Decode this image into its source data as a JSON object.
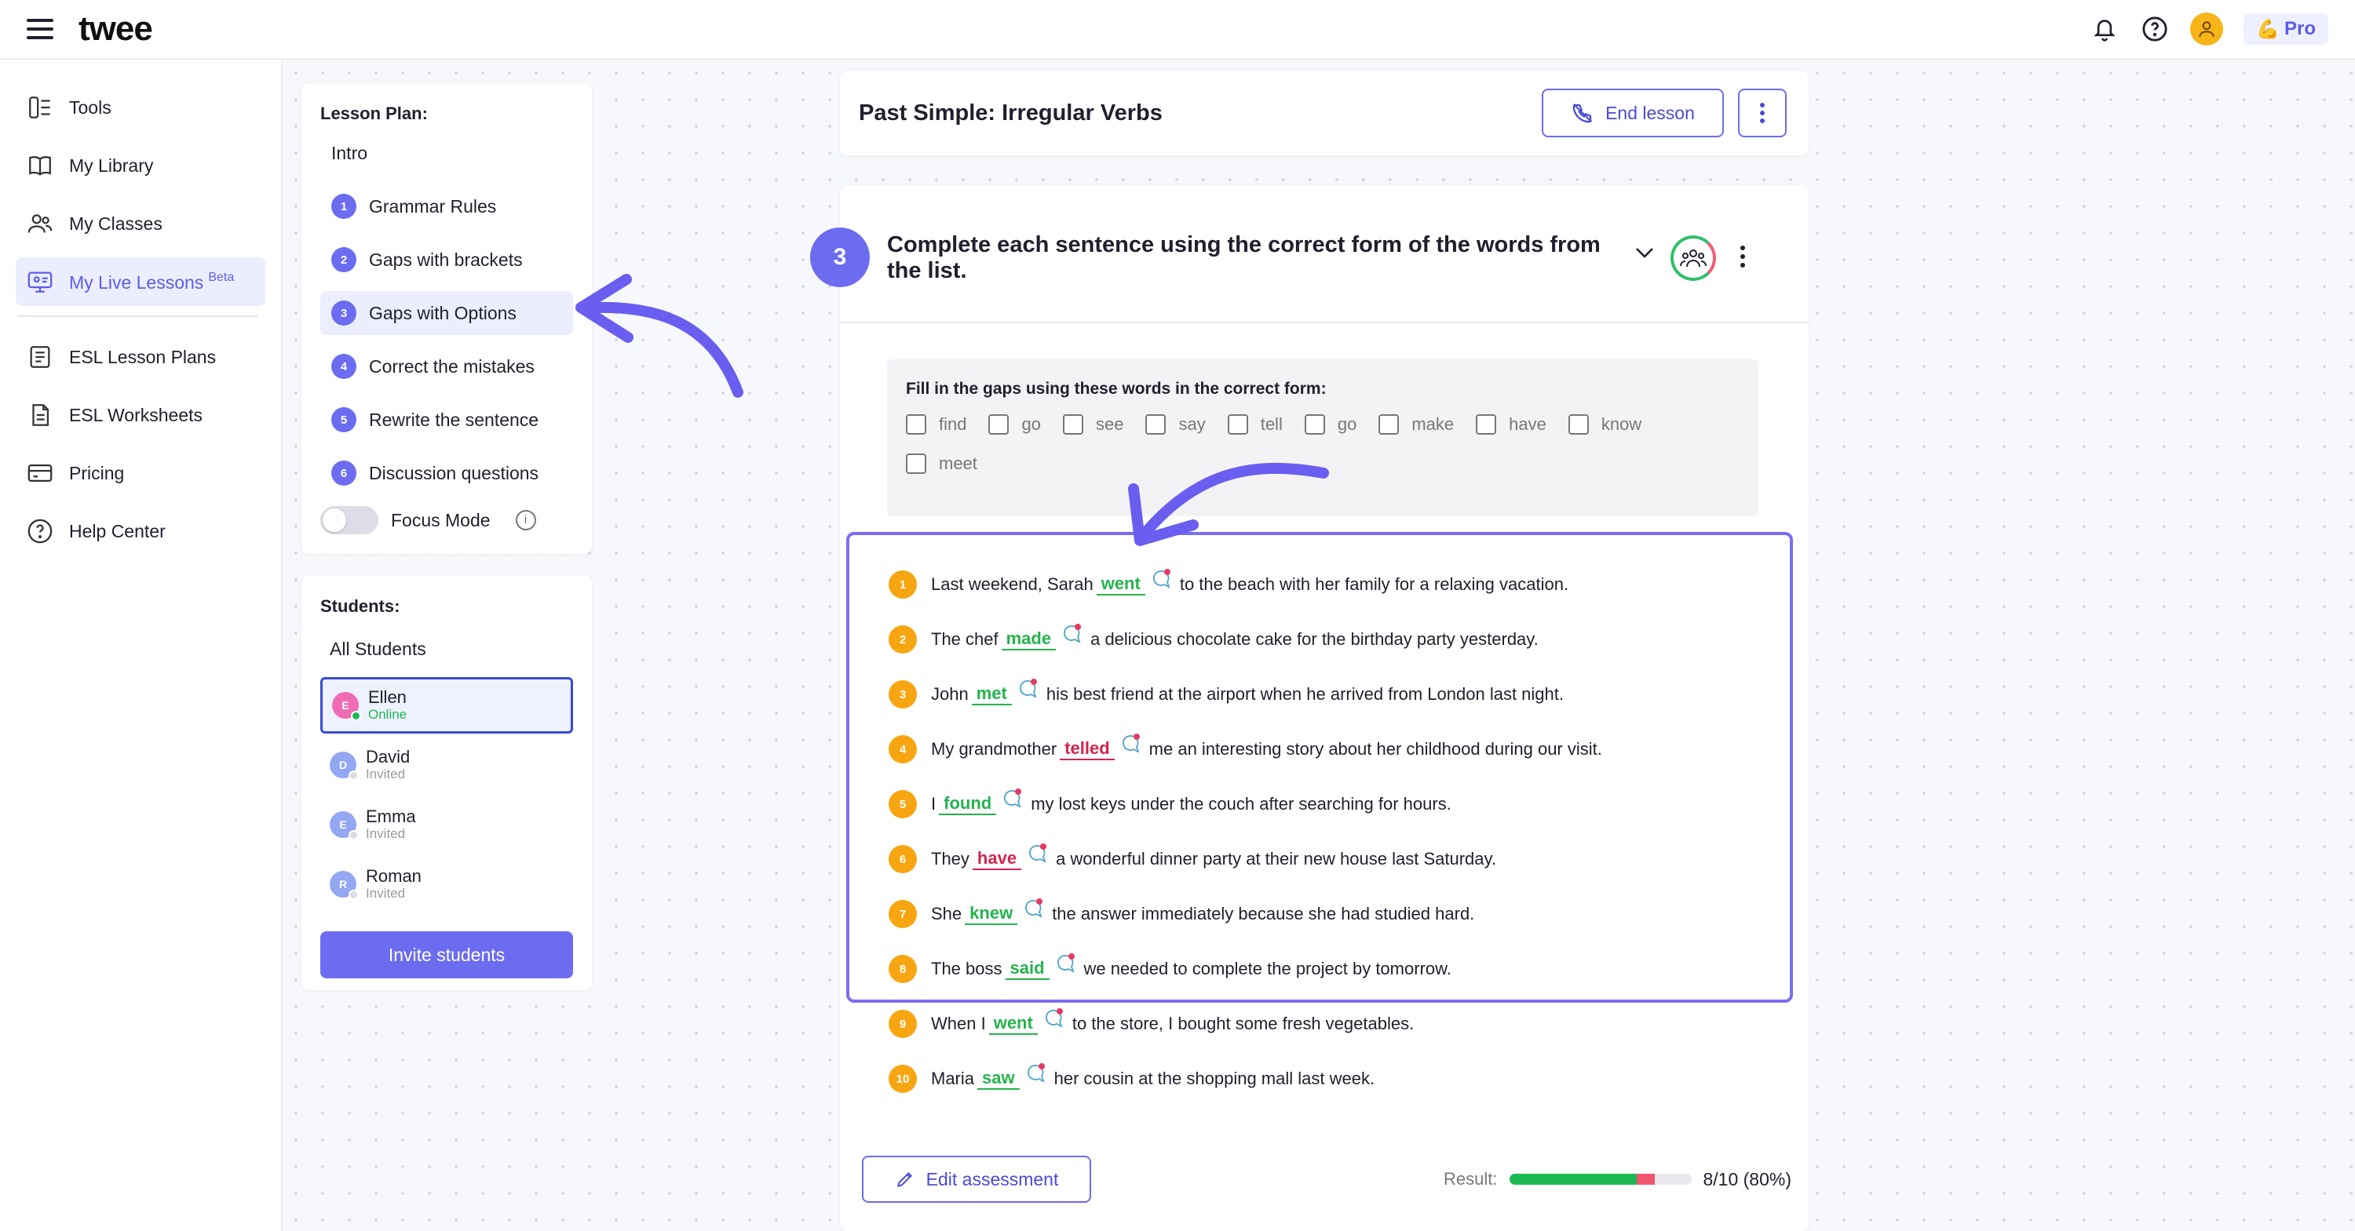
{
  "app": {
    "logo": "twee",
    "plan_badge": "Pro"
  },
  "nav": {
    "items": [
      {
        "label": "Tools",
        "icon": "tools-icon"
      },
      {
        "label": "My Library",
        "icon": "library-icon"
      },
      {
        "label": "My Classes",
        "icon": "classes-icon"
      },
      {
        "label": "My Live Lessons",
        "badge": "Beta",
        "icon": "live-lessons-icon",
        "active": true
      },
      {
        "label": "ESL Lesson Plans",
        "icon": "lesson-plans-icon"
      },
      {
        "label": "ESL Worksheets",
        "icon": "worksheets-icon"
      },
      {
        "label": "Pricing",
        "icon": "pricing-icon"
      },
      {
        "label": "Help Center",
        "icon": "help-icon"
      }
    ]
  },
  "lesson_plan": {
    "title": "Lesson Plan:",
    "intro": "Intro",
    "items": [
      {
        "num": "1",
        "label": "Grammar Rules"
      },
      {
        "num": "2",
        "label": "Gaps with brackets"
      },
      {
        "num": "3",
        "label": "Gaps with Options",
        "active": true
      },
      {
        "num": "4",
        "label": "Correct the mistakes"
      },
      {
        "num": "5",
        "label": "Rewrite the sentence"
      },
      {
        "num": "6",
        "label": "Discussion questions"
      }
    ],
    "focus_mode_label": "Focus Mode",
    "focus_mode_on": false
  },
  "students": {
    "title": "Students:",
    "all_label": "All Students",
    "list": [
      {
        "initial": "E",
        "name": "Ellen",
        "status": "Online",
        "color": "#f06bb5",
        "active": true
      },
      {
        "initial": "D",
        "name": "David",
        "status": "Invited",
        "color": "#93a7f2"
      },
      {
        "initial": "E",
        "name": "Emma",
        "status": "Invited",
        "color": "#93a7f2"
      },
      {
        "initial": "R",
        "name": "Roman",
        "status": "Invited",
        "color": "#93a7f2"
      }
    ],
    "invite_label": "Invite students"
  },
  "header": {
    "lesson_title": "Past Simple: Irregular Verbs",
    "end_label": "End lesson"
  },
  "exercise": {
    "number": "3",
    "title": "Complete each sentence using the correct form of the words from the list.",
    "word_box_title": "Fill in the gaps using these words in the correct form:",
    "words": [
      "find",
      "go",
      "see",
      "say",
      "tell",
      "go",
      "make",
      "have",
      "know",
      "meet"
    ],
    "sentences": [
      {
        "num": "1",
        "before": "Last weekend, Sarah",
        "answer": "went",
        "correct": true,
        "after": "to the beach with her family for a relaxing vacation."
      },
      {
        "num": "2",
        "before": "The chef",
        "answer": "made",
        "correct": true,
        "after": "a delicious chocolate cake for the birthday party yesterday."
      },
      {
        "num": "3",
        "before": "John",
        "answer": "met",
        "correct": true,
        "after": "his best friend at the airport when he arrived from London last night."
      },
      {
        "num": "4",
        "before": "My grandmother",
        "answer": "telled",
        "correct": false,
        "after": "me an interesting story about her childhood during our visit."
      },
      {
        "num": "5",
        "before": "I",
        "answer": "found",
        "correct": true,
        "after": "my lost keys under the couch after searching for hours."
      },
      {
        "num": "6",
        "before": "They",
        "answer": "have",
        "correct": false,
        "after": "a wonderful dinner party at their new house last Saturday."
      },
      {
        "num": "7",
        "before": "She",
        "answer": "knew",
        "correct": true,
        "after": "the answer immediately because she had studied hard."
      },
      {
        "num": "8",
        "before": "The boss",
        "answer": "said",
        "correct": true,
        "after": "we needed to complete the project by tomorrow."
      },
      {
        "num": "9",
        "before": "When I",
        "answer": "went",
        "correct": true,
        "after": "to the store, I bought some fresh vegetables."
      },
      {
        "num": "10",
        "before": "Maria",
        "answer": "saw",
        "correct": true,
        "after": "her cousin at the shopping mall last week."
      }
    ],
    "edit_label": "Edit assessment",
    "result_label": "Result:",
    "result_value": "8/10 (80%)",
    "result_fraction": 0.8
  },
  "colors": {
    "accent": "#6c6cf0",
    "correct": "#24b34e",
    "incorrect": "#d3234c",
    "number_badge": "#f7a611"
  }
}
